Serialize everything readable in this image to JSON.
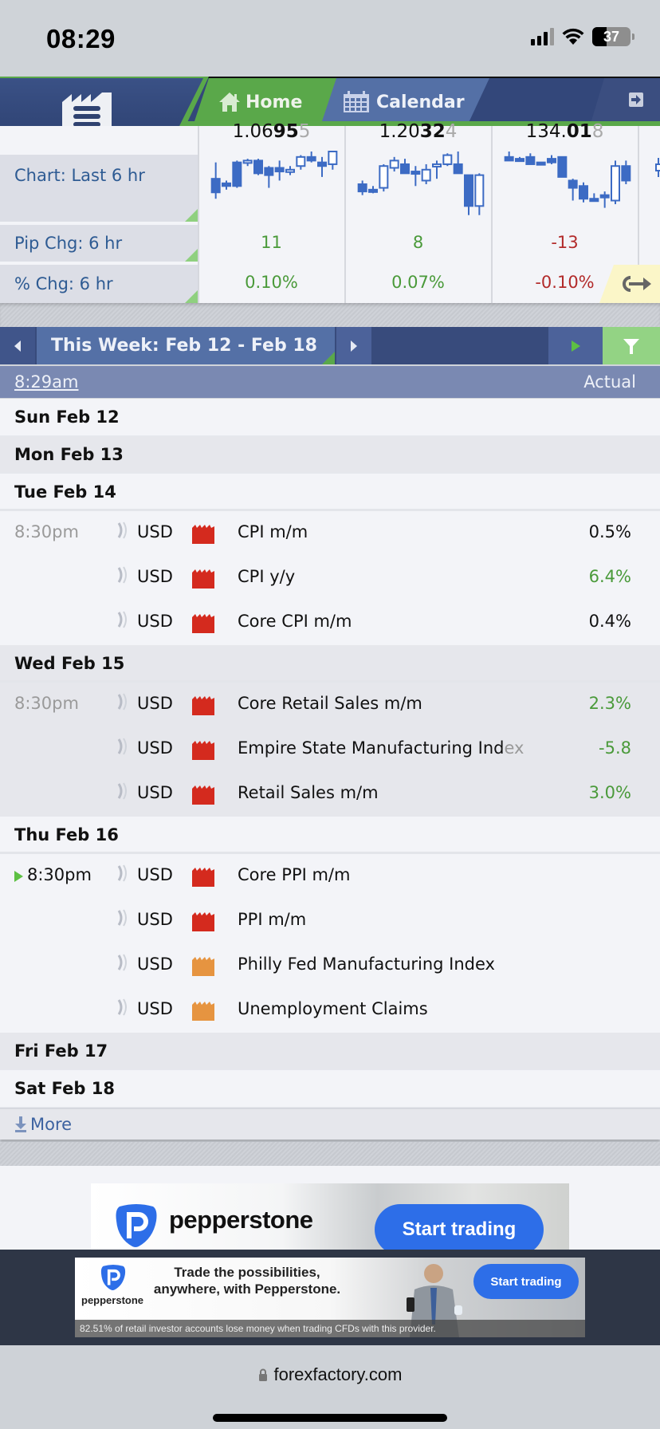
{
  "status_bar": {
    "time": "08:29",
    "battery_level": "37",
    "battery_percent": 37,
    "signal_bars": 3,
    "wifi": true
  },
  "header": {
    "menu_icon": "factory-menu-icon",
    "tabs": [
      {
        "label": "Home",
        "icon": "home-icon",
        "active": true
      },
      {
        "label": "Calendar",
        "icon": "calendar-icon",
        "active": false
      }
    ],
    "logout_icon": "logout-icon"
  },
  "market": {
    "labels": {
      "chart": "Chart: Last 6 hr",
      "pip": "Pip Chg: 6 hr",
      "pct": "% Chg: 6 hr"
    },
    "pairs": [
      {
        "price_main": "1.06",
        "price_bold": "95",
        "price_pip": "5",
        "pip_change": "11",
        "pct_change": "0.10%",
        "direction": "pos",
        "candles": [
          [
            30,
            45,
            12,
            52
          ],
          [
            35,
            38,
            32,
            42
          ],
          [
            12,
            38,
            10,
            40
          ],
          [
            12,
            10,
            8,
            16
          ],
          [
            10,
            24,
            8,
            26
          ],
          [
            18,
            26,
            16,
            40
          ],
          [
            18,
            22,
            10,
            32
          ],
          [
            22,
            20,
            16,
            26
          ],
          [
            16,
            6,
            4,
            20
          ],
          [
            6,
            10,
            0,
            12
          ],
          [
            12,
            16,
            6,
            28
          ],
          [
            14,
            0,
            0,
            20
          ]
        ]
      },
      {
        "pair": "",
        "price_main": "1.20",
        "price_bold": "32",
        "price_pip": "4",
        "pip_change": "8",
        "pct_change": "0.07%",
        "direction": "pos",
        "candles": [
          [
            36,
            44,
            32,
            48
          ],
          [
            42,
            42,
            38,
            46
          ],
          [
            40,
            16,
            14,
            44
          ],
          [
            18,
            10,
            6,
            22
          ],
          [
            14,
            24,
            8,
            24
          ],
          [
            22,
            22,
            16,
            38
          ],
          [
            32,
            20,
            14,
            36
          ],
          [
            16,
            14,
            10,
            30
          ],
          [
            14,
            4,
            2,
            16
          ],
          [
            14,
            24,
            0,
            24
          ],
          [
            26,
            60,
            26,
            70
          ],
          [
            60,
            26,
            24,
            70
          ]
        ]
      },
      {
        "pair": "",
        "price_main": "134.",
        "price_bold": "01",
        "price_pip": "8",
        "pip_change": "-13",
        "pct_change": "-0.10%",
        "direction": "neg",
        "candles": [
          [
            6,
            10,
            0,
            10
          ],
          [
            8,
            8,
            6,
            10
          ],
          [
            6,
            14,
            2,
            14
          ],
          [
            12,
            14,
            12,
            14
          ],
          [
            8,
            12,
            4,
            14
          ],
          [
            6,
            28,
            6,
            28
          ],
          [
            32,
            40,
            30,
            54
          ],
          [
            38,
            52,
            34,
            56
          ],
          [
            52,
            52,
            46,
            52
          ],
          [
            48,
            50,
            44,
            62
          ],
          [
            54,
            16,
            10,
            58
          ],
          [
            16,
            32,
            10,
            36
          ]
        ]
      }
    ]
  },
  "week_nav": {
    "title": "This Week: Feb 12 - Feb 18",
    "prev_icon": "triangle-left-icon",
    "next_icon": "triangle-right-icon",
    "jump_icon": "jump-to-next-icon",
    "filter_icon": "filter-icon"
  },
  "columns": {
    "time": "8:29am",
    "actual": "Actual"
  },
  "calendar": {
    "days": [
      {
        "label": "Sun Feb 12",
        "events": []
      },
      {
        "label": "Mon Feb 13",
        "events": []
      },
      {
        "label": "Tue Feb 14",
        "events": [
          {
            "time": "8:30pm",
            "currency": "USD",
            "impact": "high",
            "title": "CPI m/m",
            "actual": "0.5%",
            "actual_color": "neutral"
          },
          {
            "time": "",
            "currency": "USD",
            "impact": "high",
            "title": "CPI y/y",
            "actual": "6.4%",
            "actual_color": "better"
          },
          {
            "time": "",
            "currency": "USD",
            "impact": "high",
            "title": "Core CPI m/m",
            "actual": "0.4%",
            "actual_color": "neutral"
          }
        ]
      },
      {
        "label": "Wed Feb 15",
        "events": [
          {
            "time": "8:30pm",
            "currency": "USD",
            "impact": "high",
            "title": "Core Retail Sales m/m",
            "actual": "2.3%",
            "actual_color": "better"
          },
          {
            "time": "",
            "currency": "USD",
            "impact": "high",
            "title": "Empire State Manufacturing Index",
            "actual": "-5.8",
            "actual_color": "better"
          },
          {
            "time": "",
            "currency": "USD",
            "impact": "high",
            "title": "Retail Sales m/m",
            "actual": "3.0%",
            "actual_color": "better"
          }
        ]
      },
      {
        "label": "Thu Feb 16",
        "events": [
          {
            "time": "8:30pm",
            "next": true,
            "currency": "USD",
            "impact": "high",
            "title": "Core PPI m/m",
            "actual": ""
          },
          {
            "time": "",
            "currency": "USD",
            "impact": "high",
            "title": "PPI m/m",
            "actual": ""
          },
          {
            "time": "",
            "currency": "USD",
            "impact": "medium",
            "title": "Philly Fed Manufacturing Index",
            "actual": ""
          },
          {
            "time": "",
            "currency": "USD",
            "impact": "medium",
            "title": "Unemployment Claims",
            "actual": ""
          }
        ]
      },
      {
        "label": "Fri Feb 17",
        "events": []
      },
      {
        "label": "Sat Feb 18",
        "events": []
      }
    ],
    "more_label": "More"
  },
  "colors": {
    "impact_high": "#d42a1e",
    "impact_medium": "#e69440",
    "positive": "#4a9a3a",
    "negative": "#b22a2a",
    "nav_blue": "#33477a",
    "accent_green": "#5aa84a"
  },
  "ads": {
    "banner1": {
      "brand": "pepperstone",
      "cta": "Start trading"
    },
    "banner2": {
      "brand": "pepperstone",
      "headline": "Trade the possibilities, anywhere, with Pepperstone.",
      "cta": "Start trading",
      "disclaimer": "82.51% of retail investor accounts lose money when trading CFDs with this provider."
    }
  },
  "browser": {
    "url": "forexfactory.com"
  }
}
